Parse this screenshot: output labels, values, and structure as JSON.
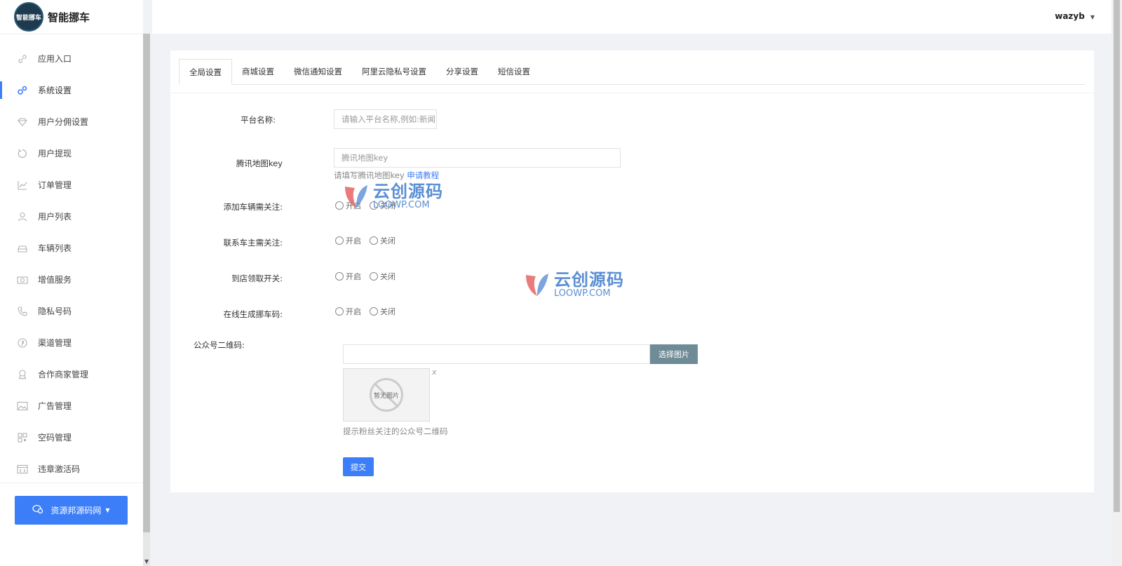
{
  "app": {
    "logo_text": "智能挪车",
    "logo_badge": "智能挪车"
  },
  "sidebar": {
    "items": [
      {
        "label": "应用入口",
        "icon": "link-icon",
        "active": false
      },
      {
        "label": "系统设置",
        "icon": "gears-icon",
        "active": true
      },
      {
        "label": "用户分佣设置",
        "icon": "diamond-icon",
        "active": false
      },
      {
        "label": "用户提现",
        "icon": "refresh-icon",
        "active": false
      },
      {
        "label": "订单管理",
        "icon": "chart-icon",
        "active": false
      },
      {
        "label": "用户列表",
        "icon": "user-icon",
        "active": false
      },
      {
        "label": "车辆列表",
        "icon": "car-icon",
        "active": false
      },
      {
        "label": "增值服务",
        "icon": "money-icon",
        "active": false
      },
      {
        "label": "隐私号码",
        "icon": "phone-icon",
        "active": false
      },
      {
        "label": "渠道管理",
        "icon": "pinterest-icon",
        "active": false
      },
      {
        "label": "合作商家管理",
        "icon": "award-icon",
        "active": false
      },
      {
        "label": "广告管理",
        "icon": "image-icon",
        "active": false
      },
      {
        "label": "空码管理",
        "icon": "qrcode-icon",
        "active": false
      },
      {
        "label": "违章激活码",
        "icon": "code-icon",
        "active": false
      }
    ],
    "bottom_button": "资源邦源码网"
  },
  "topbar": {
    "username": "wazyb"
  },
  "tabs": [
    "全局设置",
    "商城设置",
    "微信通知设置",
    "阿里云隐私号设置",
    "分享设置",
    "短信设置"
  ],
  "form": {
    "platform_name": {
      "label": "平台名称:",
      "placeholder": "请输入平台名称,例如:新闻"
    },
    "map_key": {
      "label": "腾讯地图key",
      "placeholder": "腾讯地图key",
      "help": "请填写腾讯地图key",
      "help_link": "申请教程"
    },
    "radios": [
      {
        "label": "添加车辆需关注:",
        "on": "开启",
        "off": "关闭"
      },
      {
        "label": "联系车主需关注:",
        "on": "开启",
        "off": "关闭"
      },
      {
        "label": "到店领取开关:",
        "on": "开启",
        "off": "关闭"
      },
      {
        "label": "在线生成挪车码:",
        "on": "开启",
        "off": "关闭"
      }
    ],
    "qrcode": {
      "label": "公众号二维码:",
      "button": "选择图片",
      "placeholder_text": "暂无图片",
      "remove": "x",
      "help": "提示粉丝关注的公众号二维码"
    },
    "submit": "提交"
  },
  "watermark": {
    "cn": "云创源码",
    "en": "LOOWP.COM"
  },
  "colors": {
    "accent": "#3c7ef7",
    "upload_button": "#6e8b96",
    "background": "#f1f2f6"
  }
}
